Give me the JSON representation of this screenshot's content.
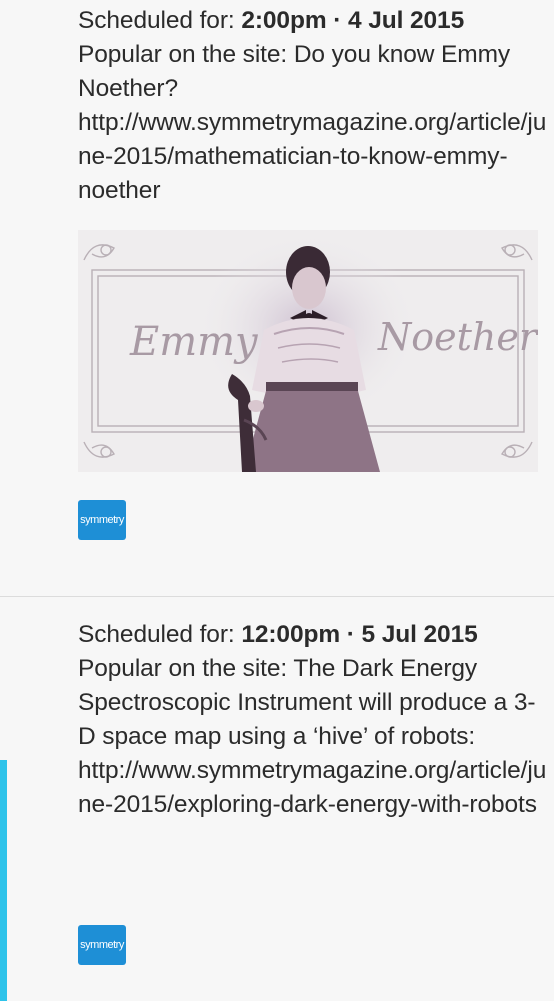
{
  "posts": [
    {
      "scheduled_label": "Scheduled for: ",
      "scheduled_time": "2:00pm · 4 Jul 2015",
      "text": "Popular on the site: Do you know Emmy Noether? http://www.symmetrymagazine.org/article/june-2015/mathematician-to-know-emmy-noether",
      "image": {
        "left_script": "Emmy",
        "right_script": "Noether"
      },
      "account_badge": "symmetry"
    },
    {
      "scheduled_label": "Scheduled for: ",
      "scheduled_time": "12:00pm · 5 Jul 2015",
      "text": "Popular on the site: The Dark Energy Spectroscopic Instrument will produce a 3-D space map using a ‘hive’ of robots: http://www.symmetrymagazine.org/article/june-2015/exploring-dark-energy-with-robots",
      "account_badge": "symmetry"
    }
  ],
  "colors": {
    "background": "#f7f7f7",
    "text": "#2b2b2b",
    "badge": "#1e8fd6",
    "accent": "#2ec3ea",
    "divider": "#dcdcdc"
  }
}
